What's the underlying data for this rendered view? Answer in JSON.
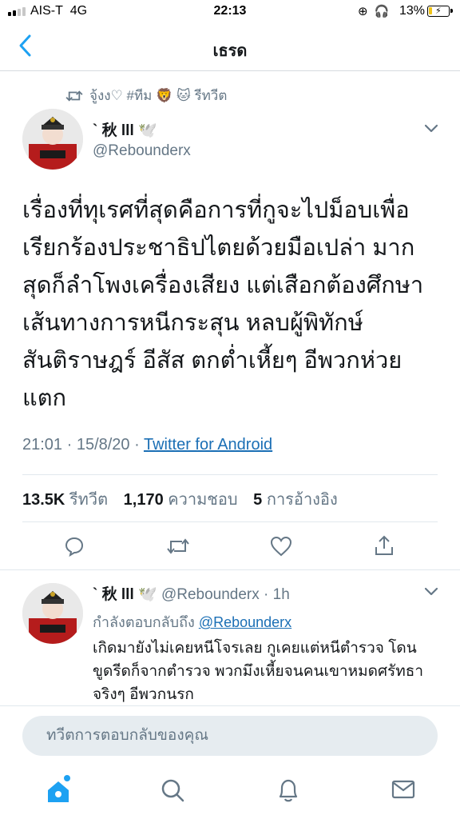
{
  "status_bar": {
    "carrier": "AIS-T",
    "network": "4G",
    "time": "22:13",
    "battery": "13%"
  },
  "nav": {
    "title": "เธรด"
  },
  "retweet_note": {
    "label": "จู้งง♡ #ทีม 🦁 🐱 รีทวีต"
  },
  "tweet": {
    "name": "` 秋 lll 🕊️",
    "handle": "@Rebounderx",
    "text": "เรื่องที่ทุเรศที่สุดคือการที่กูจะไปม็อบเพื่อเรียกร้องประชาธิปไตยด้วยมือเปล่า มากสุดก็ลำโพงเครื่องเสียง แต่เสือกต้องศึกษาเส้นทางการหนีกระสุน หลบผู้พิทักษ์สันติราษฎร์ อีสัส ตกต่ำเหี้ยๆ อีพวกห่วยแตก",
    "time": "21:01 · 15/8/20 · ",
    "source": "Twitter for Android",
    "stats": {
      "retweets": "13.5K",
      "retweets_label": "รีทวีต",
      "likes": "1,170",
      "likes_label": "ความชอบ",
      "quotes": "5",
      "quotes_label": "การอ้างอิง"
    }
  },
  "reply": {
    "name": "` 秋 lll 🕊️",
    "handle_time": "@Rebounderx · 1h",
    "replying_label": "กำลังตอบกลับถึง",
    "replying_to": "@Rebounderx",
    "text": "เกิดมายังไม่เคยหนีโจรเลย กูเคยแต่หนีตำรวจ โดนขูดรีดก็จากตำรวจ พวกมึงเหี้ยจนคนเขาหมดศรัทธาจริงๆ อีพวกนรก"
  },
  "compose": {
    "placeholder": "ทวีตการตอบกลับของคุณ"
  },
  "colors": {
    "accent": "#1da1f2",
    "link": "#1b6fb5",
    "muted": "#657786"
  }
}
